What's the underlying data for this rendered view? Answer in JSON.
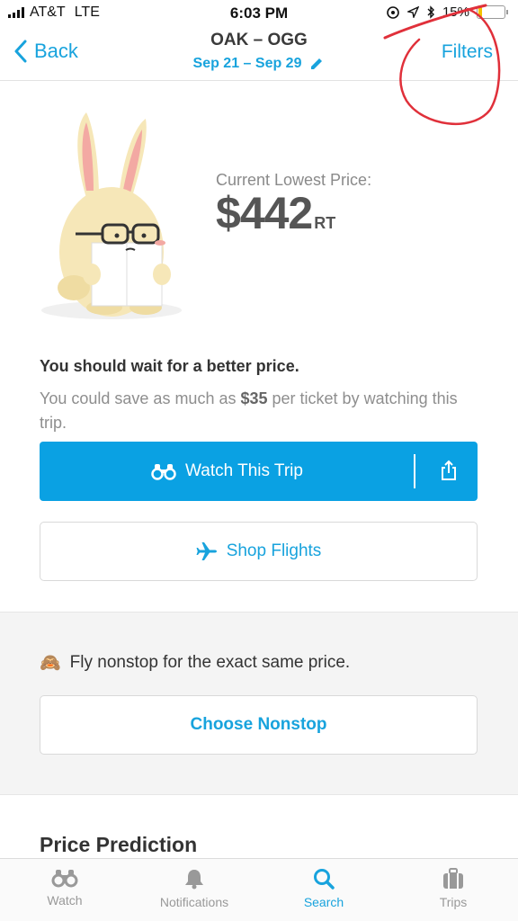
{
  "status_bar": {
    "carrier": "AT&T",
    "network": "LTE",
    "time": "6:03 PM",
    "battery_percent": "15%",
    "battery_level": 0.15
  },
  "nav": {
    "back_label": "Back",
    "route": "OAK – OGG",
    "dates": "Sep 21 – Sep 29",
    "filters_label": "Filters"
  },
  "hero": {
    "price_label": "Current Lowest Price:",
    "price_value": "$442",
    "price_suffix": "RT"
  },
  "advice": {
    "title": "You should wait for a better price.",
    "body_prefix": "You could save as much as ",
    "body_amount": "$35",
    "body_suffix": " per ticket by watching this trip."
  },
  "buttons": {
    "watch_label": "Watch This Trip",
    "shop_label": "Shop Flights",
    "nonstop_label": "Choose Nonstop"
  },
  "nonstop": {
    "emoji": "🙈",
    "text": "Fly nonstop for the exact same price."
  },
  "prediction": {
    "title": "Price Prediction"
  },
  "tabs": [
    {
      "label": "Watch",
      "icon": "binoculars-icon",
      "active": false
    },
    {
      "label": "Notifications",
      "icon": "bell-icon",
      "active": false
    },
    {
      "label": "Search",
      "icon": "search-icon",
      "active": true
    },
    {
      "label": "Trips",
      "icon": "suitcase-icon",
      "active": false
    }
  ],
  "colors": {
    "accent": "#18a3dd",
    "button_blue": "#0aa1e3",
    "annotation_red": "#e0303a"
  }
}
